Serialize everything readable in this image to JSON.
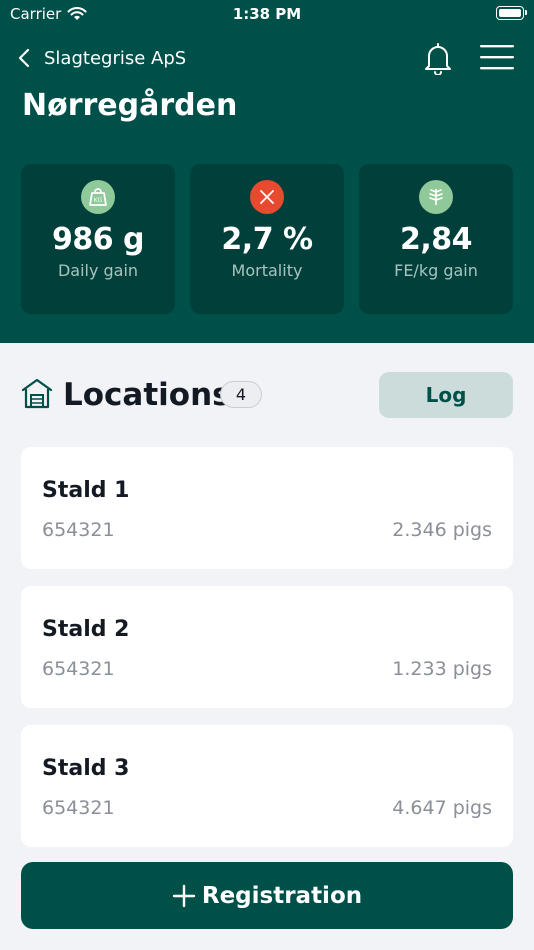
{
  "status_bar": {
    "carrier": "Carrier",
    "time": "1:38 PM"
  },
  "nav": {
    "back_label": "Slagtegrise ApS"
  },
  "farm": {
    "name": "Nørregården"
  },
  "kpis": [
    {
      "icon": "weight-icon",
      "value": "986 g",
      "label": "Daily gain",
      "icon_color": "#8fc99a",
      "icon_text": "KG"
    },
    {
      "icon": "close-icon",
      "value": "2,7 %",
      "label": "Mortality",
      "icon_color": "#e84a2f"
    },
    {
      "icon": "wheat-icon",
      "value": "2,84",
      "label": "FE/kg gain",
      "icon_color": "#8fc99a"
    }
  ],
  "locations": {
    "title": "Locations",
    "count": "4",
    "log_label": "Log",
    "items": [
      {
        "name": "Stald 1",
        "id": "654321",
        "pigs": "2.346 pigs"
      },
      {
        "name": "Stald 2",
        "id": "654321",
        "pigs": "1.233 pigs"
      },
      {
        "name": "Stald 3",
        "id": "654321",
        "pigs": "4.647 pigs"
      }
    ]
  },
  "registration": {
    "label": "Registration"
  },
  "colors": {
    "brand": "#00504a",
    "card_dark": "#003f3a",
    "accent_red": "#e84a2f",
    "accent_green": "#8fc99a"
  }
}
